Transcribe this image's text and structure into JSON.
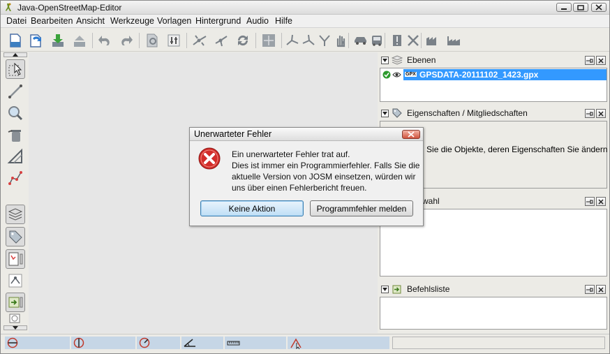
{
  "window": {
    "title": "Java-OpenStreetMap-Editor"
  },
  "menu": [
    "Datei",
    "Bearbeiten",
    "Ansicht",
    "Werkzeuge",
    "Vorlagen",
    "Hintergrund",
    "Audio",
    "Hilfe"
  ],
  "panels": {
    "layers": {
      "title": "Ebenen",
      "layer_badge": "GPX",
      "layer_name": "GPSDATA-20111102_1423.gpx"
    },
    "properties": {
      "title": "Eigenschaften / Mitgliedschaften",
      "hint": "hlen Sie die Objekte, deren Eigenschaften Sie ändern"
    },
    "selection": {
      "title": "wahl"
    },
    "commands": {
      "title": "Befehlsliste"
    }
  },
  "dialog": {
    "title": "Unerwarteter Fehler",
    "lines": [
      "Ein unerwarteter Fehler trat auf.",
      "Dies ist immer ein Programmierfehler. Falls Sie die",
      "aktuelle Version von JOSM einsetzen, würden wir",
      "uns über einen Fehlerbericht freuen."
    ],
    "button_no_action": "Keine Aktion",
    "button_report": "Programmfehler melden"
  },
  "colors": {
    "error_red": "#d22d2a",
    "selection_blue": "#3399ff",
    "status_field": "#c6d6e6"
  }
}
